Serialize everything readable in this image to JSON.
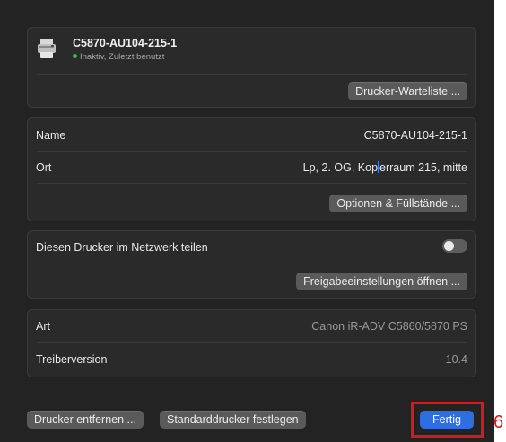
{
  "printer": {
    "name": "C5870-AU104-215-1",
    "status": "Inaktiv, Zuletzt benutzt",
    "status_color": "#2fc24c",
    "icon": "printer-icon",
    "queue_button": "Drucker-Warteliste ..."
  },
  "details": {
    "name_label": "Name",
    "name_value": "C5870-AU104-215-1",
    "location_label": "Ort",
    "location_value_before_caret": "Lp, 2. OG, Kop",
    "location_value_after_caret": "erraum 215, mitte",
    "options_button": "Optionen & Füllstände ..."
  },
  "sharing": {
    "label": "Diesen Drucker im Netzwerk teilen",
    "enabled": false,
    "settings_button": "Freigabeeinstellungen öffnen ..."
  },
  "info": {
    "type_label": "Art",
    "type_value": "Canon iR-ADV C5860/5870 PS",
    "driver_label": "Treiberversion",
    "driver_value": "10.4"
  },
  "footer": {
    "remove_button": "Drucker entfernen ...",
    "default_button": "Standarddrucker festlegen",
    "done_button": "Fertig",
    "done_color": "#2f6de2"
  },
  "annotation": {
    "step_number": "6",
    "color": "#e01515"
  }
}
